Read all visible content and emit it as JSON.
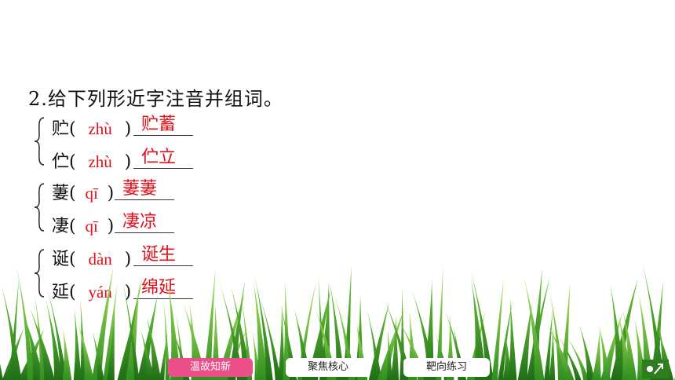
{
  "question": {
    "title": "2.给下列形近字注音并组词。"
  },
  "groups": [
    {
      "rows": [
        {
          "char": "贮",
          "pinyin": "zhù",
          "word": "贮蓄"
        },
        {
          "char": "伫",
          "pinyin": "zhù",
          "word": "伫立"
        }
      ]
    },
    {
      "rows": [
        {
          "char": "萋",
          "pinyin": "qī",
          "word": "萋萋"
        },
        {
          "char": "凄",
          "pinyin": "qī",
          "word": "凄凉"
        }
      ]
    },
    {
      "rows": [
        {
          "char": "诞",
          "pinyin": "dàn",
          "word": "诞生"
        },
        {
          "char": "延",
          "pinyin": "yán",
          "word": "绵延"
        }
      ]
    }
  ],
  "paren": {
    "open": "(",
    "close": ")"
  },
  "nav": {
    "review": "温故知新",
    "core": "聚焦核心",
    "practice": "靶向练习"
  },
  "colors": {
    "answer": "#e0101a",
    "nav_active": "#ea4f8a",
    "grass": "#4caf2e"
  }
}
